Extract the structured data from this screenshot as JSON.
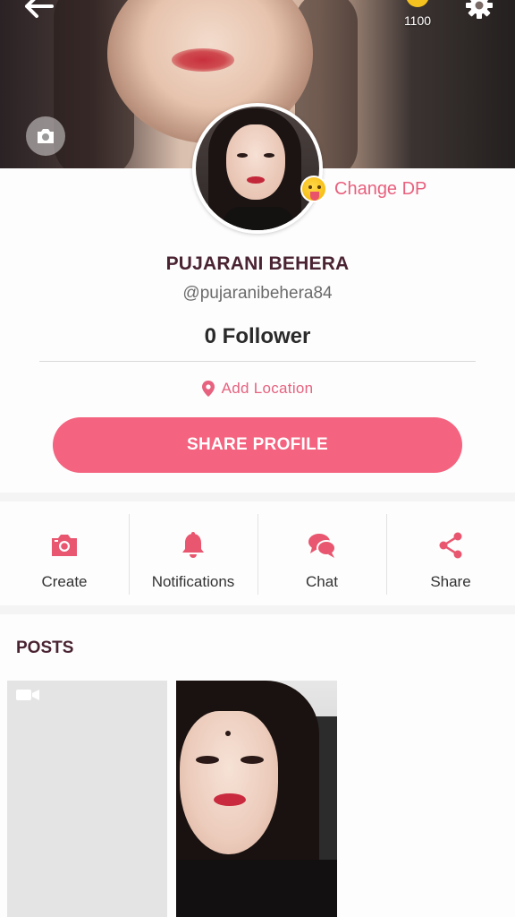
{
  "header": {
    "coins_count": "1100"
  },
  "profile": {
    "change_dp_label": "Change DP",
    "name": "PUJARANI BEHERA",
    "handle": "@pujaranibehera84",
    "followers": "0 Follower",
    "location_label": "Add Location",
    "share_button_label": "SHARE PROFILE"
  },
  "actions": [
    {
      "label": "Create",
      "icon": "camera-icon"
    },
    {
      "label": "Notifications",
      "icon": "bell-icon"
    },
    {
      "label": "Chat",
      "icon": "chat-bubbles-icon"
    },
    {
      "label": "Share",
      "icon": "share-icon"
    }
  ],
  "posts": {
    "title": "POSTS"
  },
  "colors": {
    "accent": "#f4637f",
    "name_text": "#4a2332"
  }
}
